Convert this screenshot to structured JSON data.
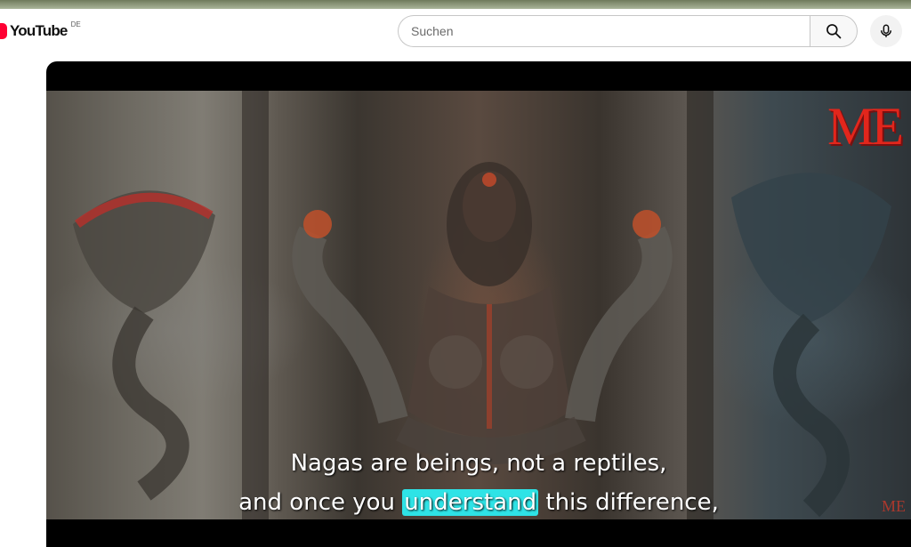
{
  "header": {
    "logo_text": "YouTube",
    "country_code": "DE",
    "search_placeholder": "Suchen",
    "search_icon": "search-icon",
    "mic_icon": "microphone-icon"
  },
  "player": {
    "watermark": "ME",
    "watermark_small": "ME",
    "captions": {
      "line1": "Nagas are beings, not a reptiles,",
      "line2_before": "and once you ",
      "line2_highlight": "understand",
      "line2_after": " this difference,"
    },
    "highlight_color": "#2ee3e6",
    "watermark_color": "#e2261c"
  },
  "colors": {
    "brand_red": "#ff0033"
  }
}
